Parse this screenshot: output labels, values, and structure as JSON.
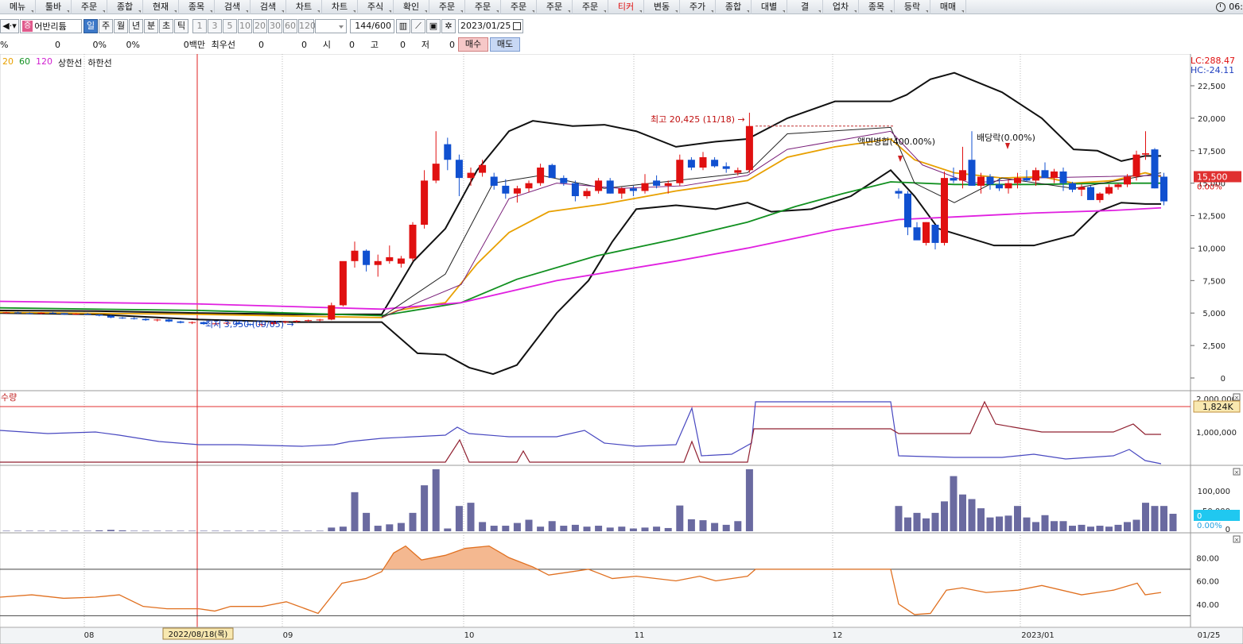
{
  "menu": {
    "items": [
      {
        "label": "메뉴"
      },
      {
        "label": "툴바"
      },
      {
        "label": "주문"
      },
      {
        "label": "종합"
      },
      {
        "label": "현재"
      },
      {
        "label": "종목"
      },
      {
        "label": "검색"
      },
      {
        "label": "검색"
      },
      {
        "label": "차트"
      },
      {
        "label": "차트"
      },
      {
        "label": "주식"
      },
      {
        "label": "확인"
      },
      {
        "label": "주문"
      },
      {
        "label": "주문"
      },
      {
        "label": "주문"
      },
      {
        "label": "주문"
      },
      {
        "label": "주문"
      },
      {
        "label": "티커"
      },
      {
        "label": "변동"
      },
      {
        "label": "주가"
      },
      {
        "label": "종합"
      },
      {
        "label": "대별"
      },
      {
        "label": "결"
      },
      {
        "label": "업차"
      },
      {
        "label": "종목"
      },
      {
        "label": "등락"
      },
      {
        "label": "매매"
      }
    ],
    "clock_text": "06:"
  },
  "toolbar": {
    "stock_tag": "증",
    "stock_name": "어반리튬",
    "periods": [
      "일",
      "주",
      "월",
      "년",
      "분",
      "초",
      "틱"
    ],
    "intervals": [
      "1",
      "3",
      "5",
      "10",
      "20",
      "30",
      "60",
      "120"
    ],
    "count": "144/600",
    "date": "2023/01/25"
  },
  "info": {
    "pct1": "%",
    "v1": "0",
    "pct2": "0%",
    "pct3": "0%",
    "amt": "0백만",
    "best_label": "최우선",
    "b1": "0",
    "b2": "0",
    "open_label": "시",
    "open": "0",
    "high_label": "고",
    "high": "0",
    "low_label": "저",
    "low": "0",
    "buy": "매수",
    "sell": "매도"
  },
  "legend": [
    {
      "label": "20",
      "color": "#e8a000"
    },
    {
      "label": "60",
      "color": "#119020"
    },
    {
      "label": "120",
      "color": "#d020d0"
    },
    {
      "label": "상한선",
      "color": "#111111"
    },
    {
      "label": "하한선",
      "color": "#111111"
    }
  ],
  "chart_data": {
    "type": "candlestick",
    "price_axis": {
      "ticks": [
        "22,500",
        "20,000",
        "17,500",
        "15,000",
        "12,500",
        "10,000",
        "7,500",
        "5,000",
        "2,500",
        "0"
      ],
      "range": [
        0,
        22500
      ]
    },
    "lc": "LC:288.47",
    "hc": "HC:-24.11",
    "current_price": "15,500",
    "current_pct": "0.00%",
    "annotations": {
      "high": "최고 20,425 (11/18)",
      "low": "최저 3,950 (09/05)",
      "split": "액면병합(400.00%)",
      "dividend": "배당락(0.00%)"
    },
    "x_axis": {
      "ticks": [
        "08",
        "09",
        "10",
        "11",
        "12",
        "2023/01",
        "01/25"
      ],
      "cursor_label": "2022/08/18(목)"
    },
    "volume_axis": {
      "ticks": [
        "100,000",
        "50,000",
        "0"
      ],
      "badge": "0",
      "badge_pct": "0.00%"
    },
    "amount_axis": {
      "ticks": [
        "2,000,000",
        "1,000,000"
      ],
      "badge": "1,824K",
      "panel_label": "수량"
    },
    "osc_axis": {
      "ticks": [
        "80.00",
        "60.00",
        "40.00"
      ],
      "upper": 70,
      "lower": 30
    },
    "candles": [
      [
        0,
        5000,
        5100,
        4950,
        5050
      ],
      [
        1,
        5050,
        5100,
        4950,
        5000
      ],
      [
        2,
        5000,
        5050,
        4900,
        4980
      ],
      [
        3,
        4980,
        5050,
        4900,
        5020
      ],
      [
        4,
        5020,
        5080,
        4950,
        4990
      ],
      [
        5,
        4990,
        5000,
        4850,
        4900
      ],
      [
        6,
        4900,
        4980,
        4850,
        4950
      ],
      [
        7,
        4950,
        5000,
        4850,
        4880
      ],
      [
        8,
        4880,
        4920,
        4750,
        4800
      ],
      [
        9,
        4800,
        4850,
        4600,
        4650
      ],
      [
        10,
        4650,
        4700,
        4550,
        4600
      ],
      [
        11,
        4600,
        4680,
        4500,
        4550
      ],
      [
        12,
        4550,
        4600,
        4400,
        4450
      ],
      [
        13,
        4450,
        4550,
        4350,
        4500
      ],
      [
        14,
        4500,
        4550,
        4300,
        4350
      ],
      [
        15,
        4350,
        4400,
        4200,
        4250
      ],
      [
        16,
        4250,
        4350,
        4150,
        4300
      ],
      [
        17,
        4300,
        4350,
        4100,
        4150
      ],
      [
        18,
        4150,
        4250,
        4050,
        4200
      ],
      [
        19,
        4200,
        4300,
        4100,
        4250
      ],
      [
        20,
        4250,
        4300,
        4100,
        4150
      ],
      [
        21,
        4150,
        4200,
        4000,
        4100
      ],
      [
        22,
        4100,
        4200,
        3950,
        4150
      ],
      [
        23,
        4150,
        4350,
        4100,
        4300
      ],
      [
        24,
        4300,
        4400,
        4200,
        4350
      ],
      [
        25,
        4350,
        4450,
        4250,
        4400
      ],
      [
        26,
        4400,
        4500,
        4300,
        4450
      ],
      [
        27,
        4450,
        4550,
        4350,
        4500
      ],
      [
        28,
        4500,
        5800,
        4450,
        5600
      ],
      [
        29,
        5600,
        7200,
        5500,
        9000
      ],
      [
        30,
        9000,
        10500,
        8500,
        9800
      ],
      [
        31,
        9800,
        9900,
        8200,
        8700
      ],
      [
        32,
        8700,
        9500,
        7800,
        9000
      ],
      [
        33,
        9000,
        10200,
        8800,
        9300
      ],
      [
        34,
        8800,
        9400,
        8500,
        9200
      ],
      [
        35,
        9200,
        12000,
        9000,
        11800
      ],
      [
        36,
        11800,
        16000,
        11500,
        15200
      ],
      [
        37,
        15200,
        19000,
        15000,
        16500
      ],
      [
        38,
        18000,
        18500,
        16000,
        16800
      ],
      [
        39,
        16800,
        17200,
        14000,
        15400
      ],
      [
        40,
        15400,
        16200,
        14800,
        15800
      ],
      [
        41,
        15800,
        16800,
        15500,
        16400
      ],
      [
        42,
        15500,
        15800,
        14500,
        14800
      ],
      [
        43,
        14800,
        15300,
        13800,
        14200
      ],
      [
        44,
        14200,
        14800,
        13500,
        14600
      ],
      [
        45,
        14600,
        15200,
        14300,
        15000
      ],
      [
        46,
        15000,
        16500,
        14800,
        16200
      ],
      [
        47,
        16400,
        16500,
        15400,
        15400
      ],
      [
        48,
        15400,
        15600,
        14800,
        15000
      ],
      [
        49,
        15000,
        15200,
        13600,
        14000
      ],
      [
        50,
        14000,
        14600,
        13800,
        14400
      ],
      [
        51,
        14400,
        15400,
        14200,
        15200
      ],
      [
        52,
        15200,
        15400,
        14200,
        14200
      ],
      [
        53,
        14200,
        14700,
        13800,
        14600
      ],
      [
        54,
        14600,
        14800,
        14000,
        14400
      ],
      [
        55,
        14400,
        15700,
        14200,
        15000
      ],
      [
        56,
        15200,
        15600,
        14600,
        14800
      ],
      [
        57,
        14800,
        15200,
        14200,
        15000
      ],
      [
        58,
        15000,
        17200,
        14800,
        16800
      ],
      [
        59,
        16800,
        17000,
        16000,
        16200
      ],
      [
        60,
        16200,
        17400,
        16000,
        17000
      ],
      [
        61,
        16800,
        17000,
        16200,
        16300
      ],
      [
        62,
        16300,
        16600,
        15800,
        16100
      ],
      [
        63,
        15800,
        16200,
        15600,
        16000
      ],
      [
        64,
        16000,
        20425,
        15800,
        19400
      ],
      [
        65,
        14400,
        14600,
        13800,
        14200
      ],
      [
        66,
        14200,
        14400,
        11000,
        11600
      ],
      [
        67,
        11600,
        12000,
        10800,
        10600
      ],
      [
        68,
        10400,
        12000,
        10200,
        12000
      ],
      [
        69,
        11800,
        11800,
        9900,
        10400
      ],
      [
        70,
        10400,
        15900,
        10200,
        15400
      ],
      [
        71,
        15400,
        16200,
        15000,
        15200
      ],
      [
        72,
        15200,
        17800,
        14600,
        16000
      ],
      [
        73,
        16800,
        19000,
        14800,
        14800
      ],
      [
        74,
        14800,
        15800,
        14200,
        15500
      ],
      [
        75,
        15500,
        15700,
        14500,
        14900
      ],
      [
        76,
        14900,
        15400,
        14400,
        14600
      ],
      [
        77,
        14600,
        15300,
        14200,
        15000
      ],
      [
        78,
        15000,
        15800,
        14600,
        15400
      ],
      [
        79,
        15400,
        16000,
        15100,
        15200
      ],
      [
        80,
        15200,
        16200,
        14800,
        16000
      ],
      [
        81,
        16000,
        16600,
        15400,
        15400
      ],
      [
        82,
        15400,
        16100,
        15000,
        15900
      ],
      [
        83,
        15900,
        16200,
        14400,
        15000
      ],
      [
        84,
        15000,
        15100,
        14300,
        14500
      ],
      [
        85,
        14500,
        14900,
        14000,
        14700
      ],
      [
        86,
        14700,
        14800,
        13700,
        13700
      ],
      [
        87,
        13700,
        14300,
        13500,
        14200
      ],
      [
        88,
        14200,
        14900,
        14100,
        14700
      ],
      [
        89,
        14700,
        15000,
        14500,
        14900
      ],
      [
        90,
        14900,
        15700,
        14700,
        15500
      ],
      [
        91,
        15500,
        17500,
        15200,
        17200
      ],
      [
        92,
        17200,
        19000,
        16800,
        17300
      ],
      [
        93,
        17600,
        17700,
        14600,
        14600
      ],
      [
        94,
        15500,
        15800,
        13300,
        13600
      ]
    ],
    "volumes": [
      1,
      1,
      1,
      1,
      1,
      1,
      1,
      1,
      2,
      3,
      2,
      1,
      1,
      1,
      1,
      1,
      1,
      1,
      1,
      1,
      1,
      1,
      1,
      1,
      1,
      1,
      1,
      1,
      8,
      10,
      85,
      40,
      12,
      15,
      18,
      40,
      100,
      135,
      6,
      55,
      62,
      20,
      12,
      12,
      18,
      25,
      10,
      22,
      12,
      14,
      10,
      12,
      8,
      10,
      6,
      8,
      10,
      7,
      56,
      26,
      24,
      18,
      14,
      22,
      135,
      55,
      30,
      40,
      28,
      40,
      65,
      120,
      80,
      70,
      50,
      30,
      32,
      34,
      55,
      30,
      20,
      35,
      22,
      22,
      12,
      14,
      10,
      12,
      10,
      14,
      20,
      25,
      62,
      55,
      55,
      38
    ],
    "gap_at": 65
  }
}
